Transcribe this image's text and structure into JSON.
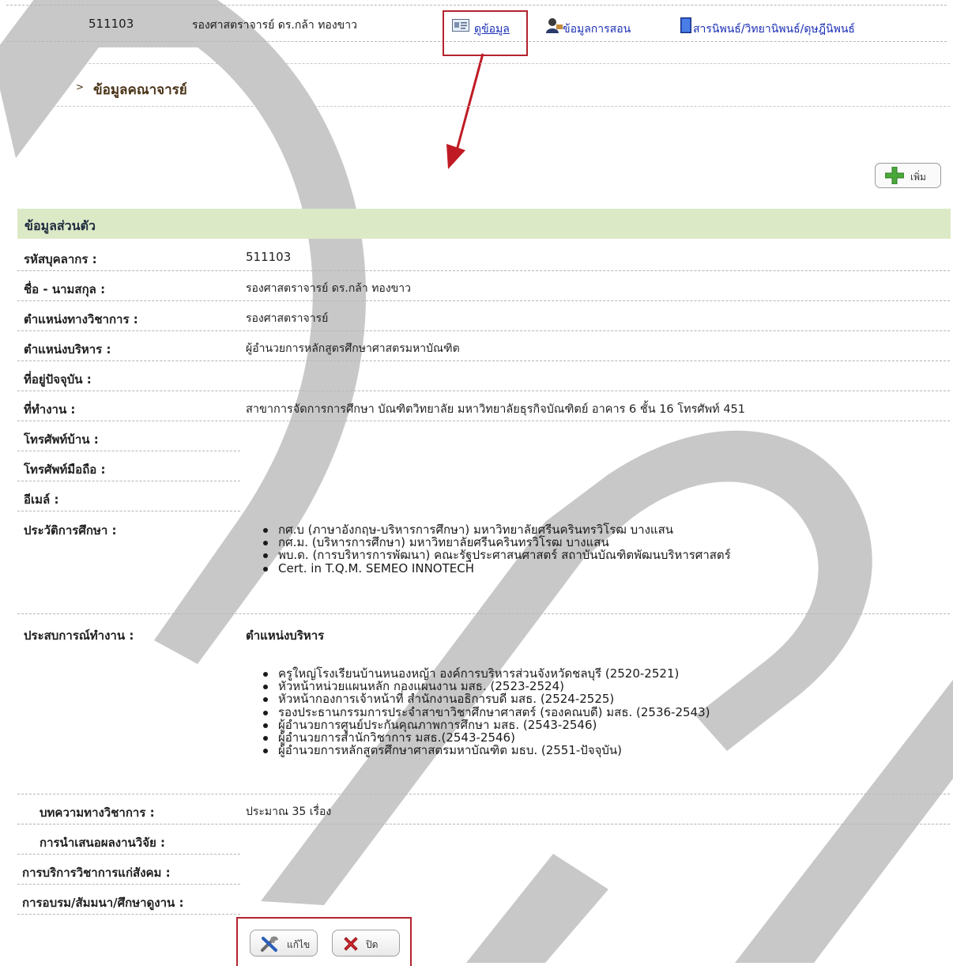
{
  "top_row": {
    "id": "511103",
    "name": "รองศาสตราจารย์ ดร.กล้า ทองขาว",
    "view_link": "ดูข้อมูล",
    "teaching_link": "ข้อมูลการสอน",
    "thesis_link": "สารนิพนธ์/วิทยานิพนธ์/ดุษฎีนิพนธ์"
  },
  "section": {
    "title": "ข้อมูลคณาจารย์"
  },
  "add_button": {
    "label": "เพิ่ม"
  },
  "profile": {
    "header": "ข้อมูลส่วนตัว",
    "fields": {
      "staff_id": {
        "label": "รหัสบุคลากร :",
        "value": "511103"
      },
      "full_name": {
        "label": "ชื่อ - นามสกุล :",
        "value": "รองศาสตราจารย์ ดร.กล้า ทองขาว"
      },
      "academic_position": {
        "label": "ตำแหน่งทางวิชาการ :",
        "value": "รองศาสตราจารย์"
      },
      "admin_position": {
        "label": "ตำแหน่งบริหาร :",
        "value": "ผู้อำนวยการหลักสูตรศึกษาศาสตรมหาบัณฑิต"
      },
      "address": {
        "label": "ที่อยู่ปัจจุบัน :",
        "value": ""
      },
      "workplace": {
        "label": "ที่ทำงาน :",
        "value": "สาขาการจัดการการศึกษา บัณฑิตวิทยาลัย มหาวิทยาลัยธุรกิจบัณฑิตย์ อาคาร 6 ชั้น 16 โทรศัพท์ 451"
      },
      "home_phone": {
        "label": "โทรศัพท์บ้าน :",
        "value": ""
      },
      "mobile": {
        "label": "โทรศัพท์มือถือ :",
        "value": ""
      },
      "email": {
        "label": "อีเมล์ :",
        "value": ""
      },
      "education": {
        "label": "ประวัติการศึกษา :",
        "items": [
          "กศ.บ (ภาษาอังกฤษ-บริหารการศึกษา) มหาวิทยาลัยศรีนครินทรวิโรฒ บางแสน",
          "กศ.ม. (บริหารการศึกษา) มหาวิทยาลัยศรีนครินทรวิโรฒ บางแสน",
          "พบ.ด. (การบริหารการพัฒนา) คณะรัฐประศาสนศาสตร์ สถาบันบัณฑิตพัฒนบริหารศาสตร์",
          "Cert. in T.Q.M.   SEMEO  INNOTECH"
        ]
      },
      "experience": {
        "label": "ประสบการณ์ทำงาน :",
        "subheading": "ตำแหน่งบริหาร",
        "items": [
          "ครูใหญ่โรงเรียนบ้านหนองหญ้า องค์การบริหารส่วนจังหวัดชลบุรี (2520-2521)",
          "หัวหน้าหน่วยแผนหลัก กองแผนงาน มสธ. (2523-2524)",
          "หัวหน้ากองการเจ้าหน้าที่ สำนักงานอธิการบดี มสธ. (2524-2525)",
          "รองประธานกรรมการประจำสาขาวิชาศึกษาศาสตร์ (รองคณบดี) มสธ. (2536-2543)",
          "ผู้อำนวยการศูนย์ประกันคุณภาพการศึกษา มสธ. (2543-2546)",
          "ผู้อำนวยการสำนักวิชาการ มสธ.(2543-2546)",
          "ผู้อำนวยการหลักสูตรศึกษาศาสตรมหาบัณฑิต มธบ. (2551-ปัจจุบัน)"
        ]
      },
      "articles": {
        "label": "บทความทางวิชาการ :",
        "value": "ประมาณ 35 เรื่อง"
      },
      "research": {
        "label": "การนำเสนอผลงานวิจัย :",
        "value": ""
      },
      "service": {
        "label": "การบริการวิชาการแก่สังคม :",
        "value": ""
      },
      "training": {
        "label": "การอบรม/สัมมนา/ศึกษาดูงาน :",
        "value": ""
      }
    }
  },
  "actions": {
    "edit_label": "แก้ไข",
    "close_label": "ปิด"
  },
  "watermark": {
    "text": "DPU"
  },
  "colors": {
    "link": "#1b2fb5",
    "highlight": "#b3232e",
    "header_bg": "#dce9c7",
    "watermark": "#c9c9c9"
  }
}
